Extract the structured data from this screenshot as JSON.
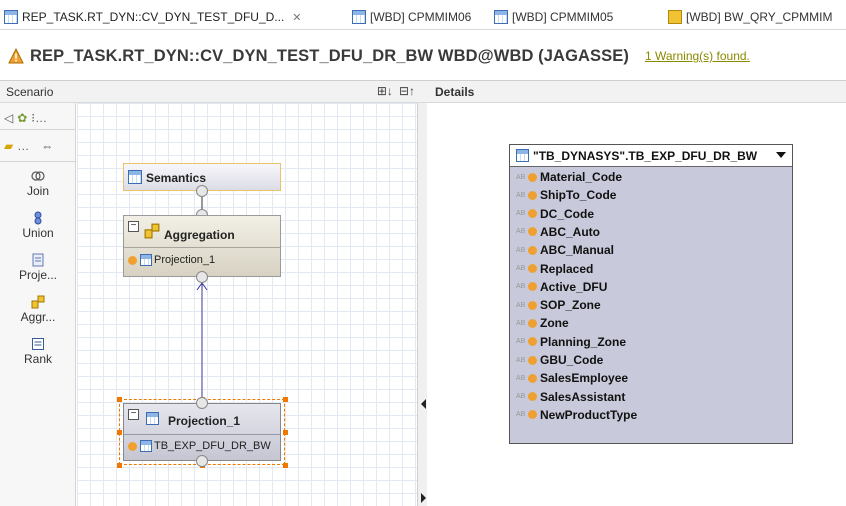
{
  "tabs": [
    {
      "label": "REP_TASK.RT_DYN::CV_DYN_TEST_DFU_D...",
      "close": "✕",
      "icon": "calc-view-icon",
      "active": true
    },
    {
      "label": "[WBD] CPMMIM06",
      "icon": "table-icon"
    },
    {
      "label": "[WBD] CPMMIM05",
      "icon": "table-icon"
    },
    {
      "label": "[WBD] BW_QRY_CPMMIM",
      "icon": "chart-icon"
    }
  ],
  "header": {
    "title": "REP_TASK.RT_DYN::CV_DYN_TEST_DFU_DR_BW WBD@WBD (JAGASSE)",
    "warning_link": "1 Warning(s) found.",
    "warning_color": "#f0a030"
  },
  "scenario": {
    "title": "Scenario",
    "buttons": [
      "⊞↓",
      "⊟↑"
    ],
    "palette_row1": "⁝…",
    "palette_row2": "…",
    "tools": [
      {
        "label": "Join",
        "icon": "join-icon"
      },
      {
        "label": "Union",
        "icon": "union-icon"
      },
      {
        "label": "Proje...",
        "icon": "projection-icon"
      },
      {
        "label": "Aggr...",
        "icon": "aggregation-icon"
      },
      {
        "label": "Rank",
        "icon": "rank-icon"
      }
    ]
  },
  "diagram": {
    "semantics_label": "Semantics",
    "aggregation": {
      "title": "Aggregation",
      "input": "Projection_1"
    },
    "projection": {
      "title": "Projection_1",
      "input": "TB_EXP_DFU_DR_BW"
    }
  },
  "details": {
    "title": "Details",
    "table": {
      "name": "\"TB_DYNASYS\".TB_EXP_DFU_DR_BW",
      "columns": [
        "Material_Code",
        "ShipTo_Code",
        "DC_Code",
        "ABC_Auto",
        "ABC_Manual",
        "Replaced",
        "Active_DFU",
        "SOP_Zone",
        "Zone",
        "Planning_Zone",
        "GBU_Code",
        "SalesEmployee",
        "SalesAssistant",
        "NewProductType"
      ],
      "type_badge": "AB"
    }
  },
  "colors": {
    "accent_orange": "#f07800",
    "table_bg": "#c8c9da",
    "grid_line": "#e3e9f2"
  }
}
